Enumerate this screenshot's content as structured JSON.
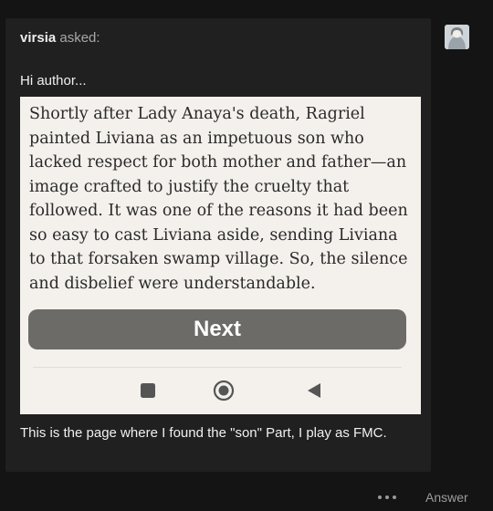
{
  "post": {
    "asker_name": "virsia",
    "asker_verb": "asked:",
    "greeting": "Hi author...",
    "caption": "This is the page where I found the \"son\" Part, I play as FMC."
  },
  "screenshot": {
    "passage": "Shortly after Lady Anaya's death, Ragriel painted Liviana as an impetuous son who lacked respect for both mother and father—an image crafted to justify the cruelty that followed. It was one of the reasons it had been so easy to cast Liviana aside, sending Liviana to that forsaken swamp village. So, the silence and disbelief were understandable.",
    "next_label": "Next",
    "nav_icons": [
      "recents-square-icon",
      "home-circle-icon",
      "back-triangle-icon"
    ]
  },
  "footer": {
    "more_icon": "more-dots-icon",
    "answer_label": "Answer"
  },
  "colors": {
    "page_bg": "#141414",
    "card_bg": "#202020",
    "shot_bg": "#f4f1ec",
    "next_button_bg": "#6d6b68"
  }
}
